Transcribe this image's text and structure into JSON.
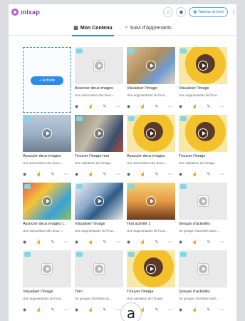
{
  "brand": {
    "name": "mixap",
    "color": "#b65ad6"
  },
  "topbar": {
    "icons": [
      "home-icon",
      "eye-icon"
    ],
    "dashboard_label": "Tableau de bord"
  },
  "tabs": [
    {
      "label": "Mon Contenu",
      "icon": "grid-icon",
      "active": true
    },
    {
      "label": "Suivi d'Apprenants",
      "icon": "search-icon",
      "active": false
    }
  ],
  "add_activity": {
    "label": "+ Activité"
  },
  "cards": [
    {
      "title": "Associer deux images",
      "desc": "Une association des deux i...",
      "thumb": "placeholder"
    },
    {
      "title": "Visualiser l'image",
      "desc": "Une augmentation de l'ima...",
      "thumb": "room"
    },
    {
      "title": "Visualiser l'image",
      "desc": "Une augmentation de l'ima...",
      "thumb": "child-yellow"
    },
    {
      "title": "Associer deux images",
      "desc": "Une association des deux i...",
      "thumb": "arms"
    },
    {
      "title": "Trouver l'image test",
      "desc": "Une validation de l'image",
      "thumb": "street"
    },
    {
      "title": "Associer deux images",
      "desc": "Une association des deux i...",
      "thumb": "child-yellow"
    },
    {
      "title": "Trouver l'image",
      "desc": "Une validation de l'image",
      "thumb": "child-yellow"
    },
    {
      "title": "Associer deux images t...",
      "desc": "Une association des deux i...",
      "thumb": "colorful"
    },
    {
      "title": "Visualiser l'image",
      "desc": "Une augmentation de l'ima...",
      "thumb": "diagonal"
    },
    {
      "title": "Test activité 1",
      "desc": "Une augmentation de l'ima...",
      "thumb": "tree"
    },
    {
      "title": "Groupe d'activités",
      "desc": "Un groupe d'activités sans ...",
      "thumb": "placeholder"
    },
    {
      "title": "Visualiser l'image",
      "desc": "Une augmentation de l'ima...",
      "thumb": "placeholder"
    },
    {
      "title": "Torri",
      "desc": "Un groupe d'activités sa...",
      "thumb": "placeholder"
    },
    {
      "title": "Trouver l'image",
      "desc": "Une validation de l'image",
      "thumb": "child-yellow"
    },
    {
      "title": "Groupe d'activités",
      "desc": "Un groupe d'activités sans ...",
      "thumb": "placeholder"
    }
  ],
  "card_actions": [
    "eye-icon",
    "thumb-up-icon",
    "pencil-icon",
    "more-icon"
  ],
  "bubble": {
    "label": "a"
  },
  "colors": {
    "accent": "#2d8ce6",
    "border": "#e6e8eb"
  }
}
